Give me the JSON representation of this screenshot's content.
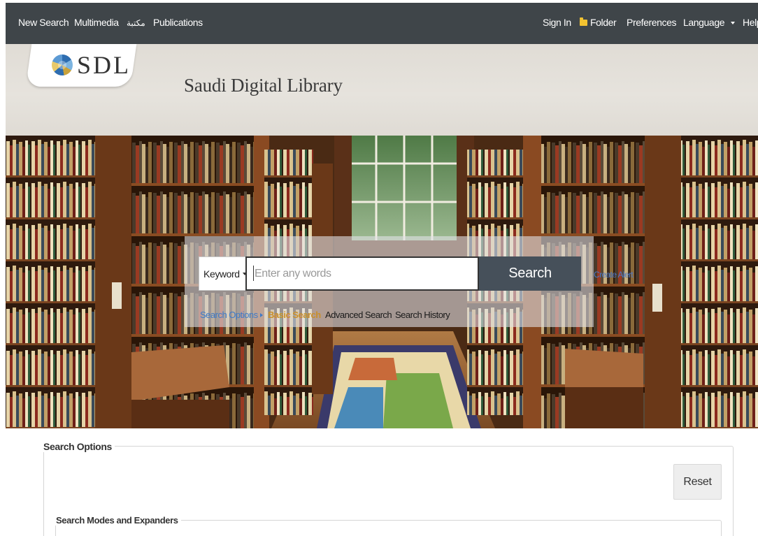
{
  "topnav": {
    "new_search": "New Search",
    "multimedia": "Multimedia",
    "arabic_library": "مكتبة",
    "publications": "Publications",
    "sign_in": "Sign In",
    "folder": "Folder",
    "preferences": "Preferences",
    "language": "Language",
    "help": "Help"
  },
  "header": {
    "logo_text": "SDL",
    "site_title": "Saudi Digital Library"
  },
  "search": {
    "field_select": "Keyword",
    "placeholder": "Enter any words",
    "value": "",
    "button": "Search",
    "create_alert": "Create Alert",
    "search_options_link": "Search Options",
    "basic_search": "Basic Search",
    "advanced_search": "Advanced Search",
    "search_history": "Search History"
  },
  "options": {
    "legend": "Search Options",
    "reset": "Reset",
    "modes_legend": "Search Modes and Expanders"
  },
  "colors": {
    "nav_bg": "#3f4549",
    "search_button": "#46505a",
    "basic_search_active": "#c98f2a",
    "link_blue": "#3d7ac8"
  },
  "icons": {
    "folder": "folder-icon",
    "language_dropdown": "chevron-down-icon",
    "select_dropdown": "chevron-down-icon",
    "search_options": "triangle-right-icon"
  }
}
